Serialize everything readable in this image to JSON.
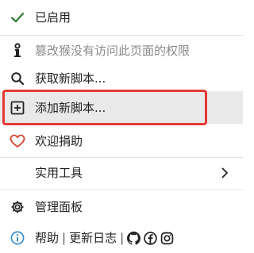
{
  "menu": {
    "enabled_label": "已启用",
    "no_access_label": "篡改猴没有访问此页面的权限",
    "get_scripts_label": "获取新脚本...",
    "add_script_label": "添加新脚本...",
    "donate_label": "欢迎捐助",
    "utilities_label": "实用工具",
    "dashboard_label": "管理面板",
    "help_label": "帮助",
    "changelog_label": "更新日志",
    "separator": "|"
  },
  "colors": {
    "check": "#2e7d32",
    "heart": "#d94c3b",
    "info": "#3a8fd0",
    "highlight": "#e53935"
  },
  "icons": {
    "enabled": "checkmark-icon",
    "no_access": "restricted-icon",
    "get_scripts": "search-icon",
    "add_script": "plus-square-icon",
    "donate": "heart-icon",
    "utilities": "chevron-right-icon",
    "dashboard": "gear-icon",
    "help": "info-icon",
    "social": [
      "github-icon",
      "facebook-icon",
      "instagram-icon"
    ]
  }
}
